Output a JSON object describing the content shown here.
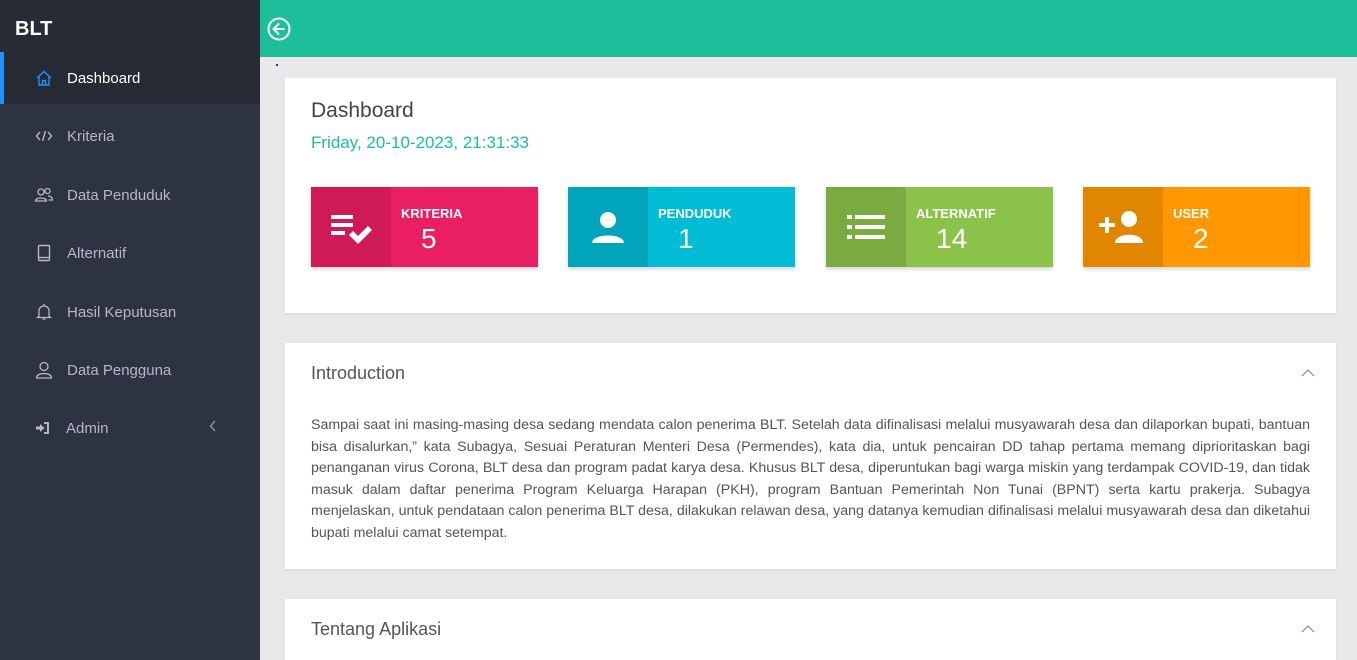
{
  "brand": "BLT",
  "sidebar": {
    "items": [
      {
        "label": "Dashboard",
        "icon": "home-icon",
        "active": true
      },
      {
        "label": "Kriteria",
        "icon": "code-icon"
      },
      {
        "label": "Data Penduduk",
        "icon": "users-icon"
      },
      {
        "label": "Alternatif",
        "icon": "book-icon"
      },
      {
        "label": "Hasil Keputusan",
        "icon": "bell-icon"
      },
      {
        "label": "Data Pengguna",
        "icon": "user-icon"
      },
      {
        "label": "Admin",
        "icon": "sign-in-icon"
      }
    ]
  },
  "dashboard": {
    "title": "Dashboard",
    "datetime": "Friday, 20-10-2023, 21:31:33",
    "stats": [
      {
        "label": "KRITERIA",
        "value": "5",
        "icon": "checklist-icon",
        "color": "#e91e63",
        "dark": "#cf1a57"
      },
      {
        "label": "PENDUDUK",
        "value": "1",
        "icon": "person-icon",
        "color": "#00bcd4",
        "dark": "#00a5bb"
      },
      {
        "label": "ALTERNATIF",
        "value": "14",
        "icon": "list-icon",
        "color": "#8bc34a",
        "dark": "#7aab41"
      },
      {
        "label": "USER",
        "value": "2",
        "icon": "add-user-icon",
        "color": "#ff9800",
        "dark": "#e08600"
      }
    ]
  },
  "intro": {
    "title": "Introduction",
    "text": "Sampai saat ini masing-masing desa sedang mendata calon penerima BLT. Setelah data difinalisasi melalui musyawarah desa dan dilaporkan bupati, bantuan bisa disalurkan,” kata Subagya, Sesuai Peraturan Menteri Desa (Permendes), kata dia, untuk pencairan DD tahap pertama memang diprioritaskan bagi penanganan virus Corona, BLT desa dan program padat karya desa. Khusus BLT desa, diperuntukan bagi warga miskin yang terdampak COVID-19, dan tidak masuk dalam daftar penerima Program Keluarga Harapan (PKH), program Bantuan Pemerintah Non Tunai (BPNT) serta kartu prakerja. Subagya menjelaskan, untuk pendataan calon penerima BLT desa, dilakukan relawan desa, yang datanya kemudian difinalisasi melalui musyawarah desa dan diketahui bupati melalui camat setempat."
  },
  "about": {
    "title": "Tentang Aplikasi"
  }
}
